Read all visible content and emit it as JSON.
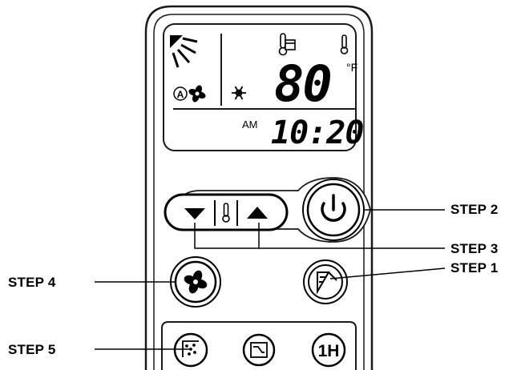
{
  "display": {
    "temperature": "80",
    "unit": "°F",
    "am_pm": "AM",
    "time": "10:20"
  },
  "labels": {
    "step1": "STEP 1",
    "step2": "STEP 2",
    "step3": "STEP 3",
    "step4": "STEP 4",
    "step5": "STEP 5"
  },
  "buttons": {
    "timer_label": "1H"
  },
  "icons": {
    "lcd_louver": "louver-swing-icon",
    "lcd_auto_fan": "auto-fan-icon",
    "lcd_snowflake": "snowflake-icon",
    "lcd_room_temp": "room-thermometer-icon",
    "lcd_set_temp": "set-thermometer-icon",
    "down": "down-arrow-icon",
    "thermo": "thermometer-icon",
    "up": "up-arrow-icon",
    "power": "power-icon",
    "fan": "fan-icon",
    "mode": "mode-louver-icon",
    "sleep": "sleep-icon",
    "schedule": "schedule-icon"
  },
  "colors": {
    "line": "#1a1a1a",
    "body": "#ffffff"
  }
}
